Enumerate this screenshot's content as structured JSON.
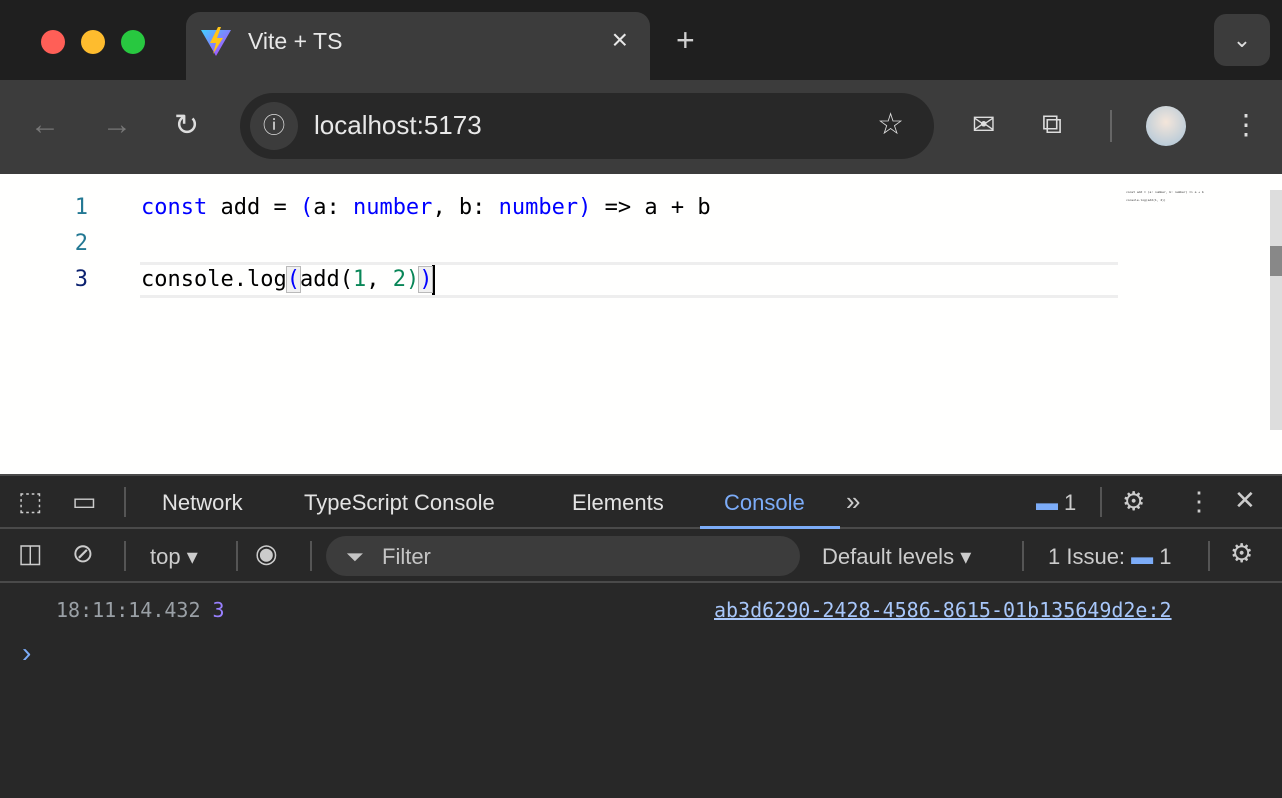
{
  "browser": {
    "tab": {
      "title": "Vite + TS",
      "close_icon": "×",
      "favicon": "vite-logo"
    },
    "new_tab_icon": "+",
    "tab_search_icon": "⌄",
    "address": "localhost:5173",
    "colors": {
      "close": "#ff5f57",
      "minimize": "#febc2e",
      "maximize": "#28c840"
    }
  },
  "editor": {
    "line_numbers": [
      "1",
      "2",
      "3"
    ],
    "line1": {
      "kw": "const",
      "t1": " add = ",
      "p1": "(",
      "t2": "a: ",
      "ty1": "number",
      "t3": ", b: ",
      "ty2": "number",
      "p2": ")",
      "t4": " => a + b"
    },
    "line3": {
      "t1": "console.log",
      "p1": "(",
      "t2": "add(",
      "n1": "1",
      "t3": ", ",
      "n2": "2",
      "p2": ")",
      "p3": ")"
    },
    "minimap": [
      "const add = (a: number, b: number) => a + b",
      "console.log(add(1, 2))"
    ]
  },
  "devtools": {
    "tabs": [
      "Network",
      "TypeScript Console",
      "Elements",
      "Console"
    ],
    "selected_tab": "Console",
    "messages_count": "1",
    "context": "top",
    "filter_placeholder": "Filter",
    "levels": "Default levels",
    "issues_label": "1 Issue:",
    "issues_count": "1",
    "log": {
      "timestamp": "18:11:14.432",
      "value": "3",
      "source": "ab3d6290-2428-4586-8615-01b135649d2e:2"
    },
    "prompt": "›"
  }
}
